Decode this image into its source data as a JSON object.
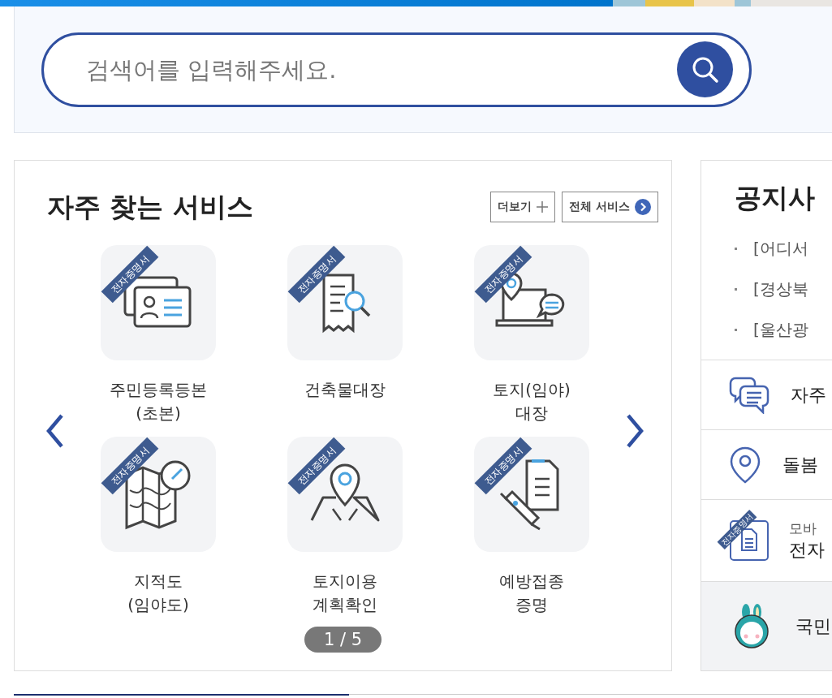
{
  "search": {
    "placeholder": "검색어를 입력해주세요."
  },
  "services": {
    "title": "자주 찾는 서비스",
    "buttons": [
      {
        "label": "더보기",
        "kind": "more"
      },
      {
        "label": "전체 서비스",
        "kind": "all"
      }
    ],
    "items": [
      {
        "kind": "id-card",
        "badge": "전자증명서",
        "lines": [
          "주민등록등본",
          "(초본)"
        ]
      },
      {
        "kind": "receipt",
        "badge": "전자증명서",
        "lines": [
          "건축물대장"
        ]
      },
      {
        "kind": "laptop",
        "badge": "전자증명서",
        "lines": [
          "토지(임야)",
          "대장"
        ]
      },
      {
        "kind": "map",
        "badge": "전자증명서",
        "lines": [
          "지적도",
          "(임야도)"
        ]
      },
      {
        "kind": "land",
        "badge": "전자증명서",
        "lines": [
          "토지이용",
          "계획확인"
        ]
      },
      {
        "kind": "vaccine",
        "badge": "전자증명서",
        "lines": [
          "예방접종",
          "증명"
        ]
      }
    ],
    "pager": "1 / 5"
  },
  "notice": {
    "title": "공지사",
    "items": [
      "[어디서",
      "[경상북",
      "[울산광"
    ]
  },
  "links": [
    {
      "kind": "chat",
      "label": "자주",
      "selected": false
    },
    {
      "kind": "pin",
      "label": "돌봄",
      "selected": false
    },
    {
      "kind": "mobile",
      "sublabel": "모바",
      "label": "전자",
      "badge": "전자증명서",
      "selected": false
    },
    {
      "kind": "mascot",
      "label": "국민",
      "selected": true
    }
  ]
}
